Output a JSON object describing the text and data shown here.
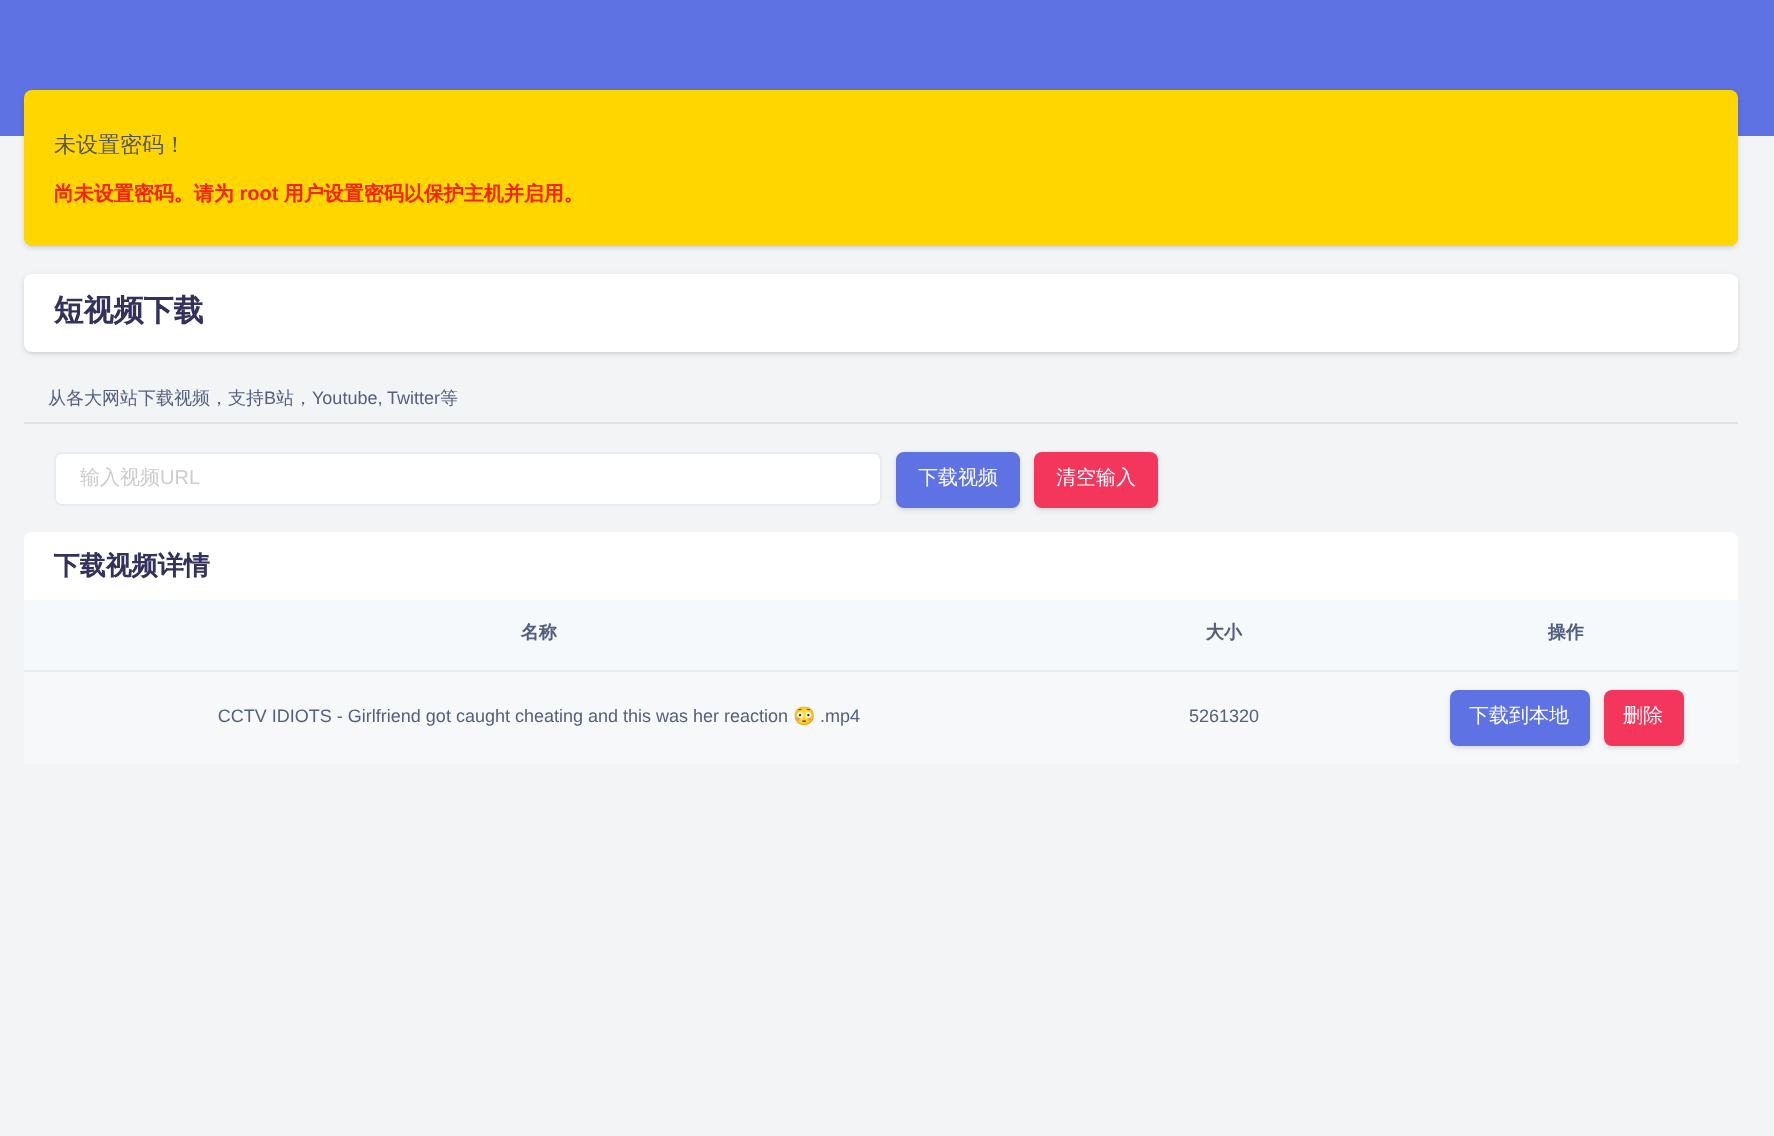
{
  "alert": {
    "title": "未设置密码！",
    "message": "尚未设置密码。请为 root 用户设置密码以保护主机并启用。"
  },
  "section": {
    "title": "短视频下载",
    "description": "从各大网站下载视频，支持B站，Youtube, Twitter等"
  },
  "url_field": {
    "placeholder": "输入视频URL"
  },
  "buttons": [
    "下载视频",
    "清空输入"
  ],
  "details": {
    "title": "下载视频详情",
    "columns": [
      "名称",
      "大小",
      "操作"
    ],
    "rows": [
      {
        "name": "CCTV IDIOTS - Girlfriend got caught cheating and this was her reaction 😳 .mp4",
        "size": "5261320",
        "actions": [
          "下载到本地",
          "删除"
        ]
      }
    ]
  }
}
